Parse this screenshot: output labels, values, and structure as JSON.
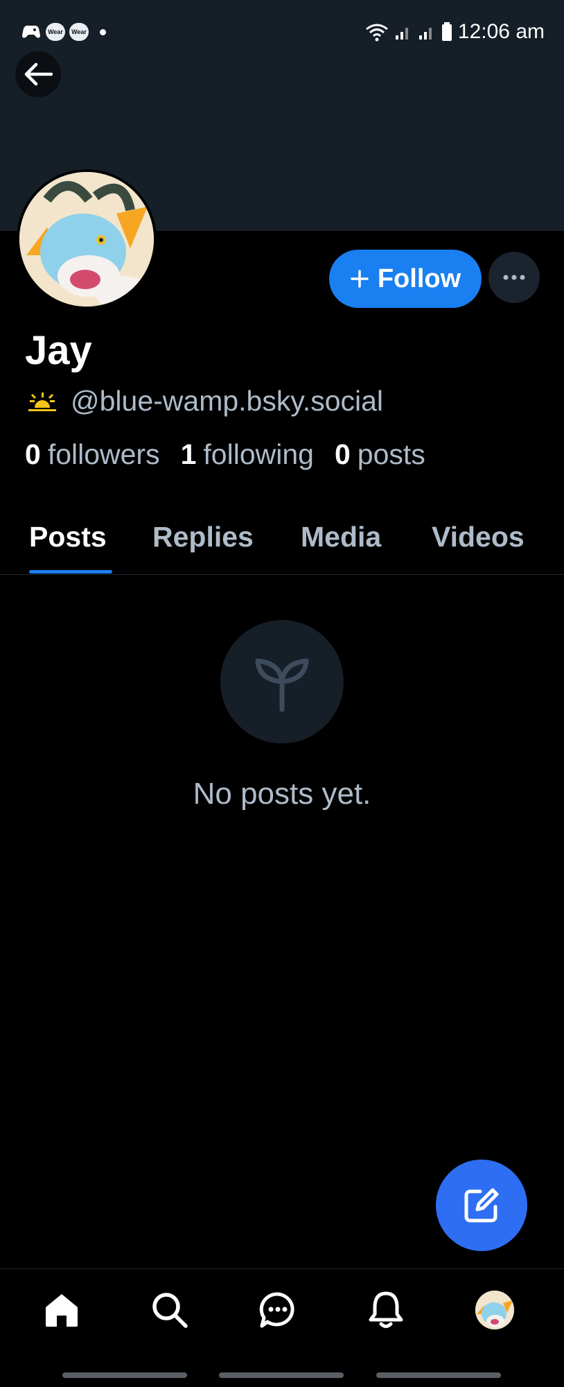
{
  "status_bar": {
    "notifications": [
      "Wear",
      "Wear"
    ],
    "time": "12:06 am"
  },
  "profile": {
    "display_name": "Jay",
    "handle": "@blue-wamp.bsky.social",
    "handle_icon": "sunrise-icon",
    "stats": {
      "followers_count": "0",
      "followers_label": "followers",
      "following_count": "1",
      "following_label": "following",
      "posts_count": "0",
      "posts_label": "posts"
    }
  },
  "actions": {
    "follow_label": "Follow",
    "more_label": "···"
  },
  "tabs": [
    {
      "label": "Posts",
      "active": true
    },
    {
      "label": "Replies",
      "active": false
    },
    {
      "label": "Media",
      "active": false
    },
    {
      "label": "Videos",
      "active": false
    }
  ],
  "empty_state": {
    "icon": "seedling-icon",
    "text": "No posts yet."
  },
  "bottom_nav": [
    "home-icon",
    "search-icon",
    "chat-icon",
    "bell-icon",
    "profile-avatar"
  ],
  "colors": {
    "accent": "#1a7ff0",
    "fab": "#2e6ef2",
    "banner": "#161e27",
    "muted_text": "#aebbc9",
    "handle_icon": "#f5c518"
  }
}
